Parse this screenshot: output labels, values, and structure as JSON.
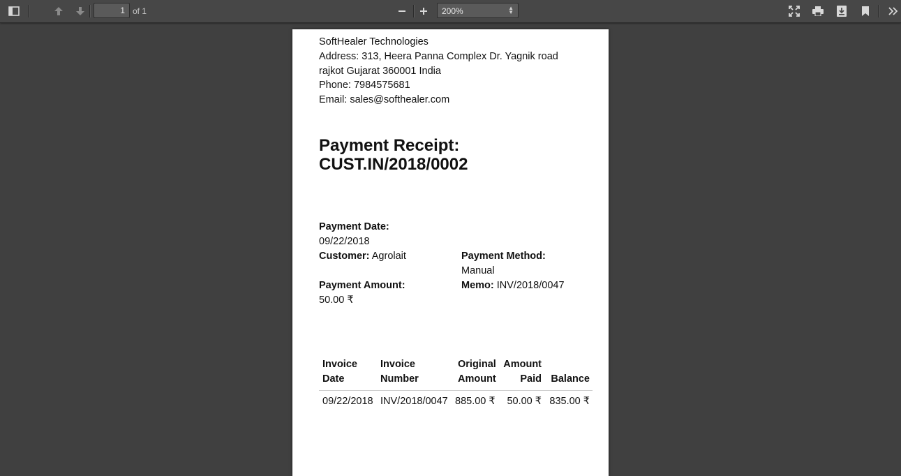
{
  "toolbar": {
    "page_current": "1",
    "page_total": "of 1",
    "zoom": "200%"
  },
  "company": {
    "name": "SoftHealer Technologies",
    "address_line1": "Address: 313, Heera Panna Complex Dr. Yagnik road",
    "address_line2": "rajkot Gujarat 360001 India",
    "phone": "Phone: 7984575681",
    "email": "Email: sales@softhealer.com"
  },
  "receipt": {
    "title_line1": "Payment Receipt:",
    "title_line2": "CUST.IN/2018/0002",
    "payment_date_label": "Payment Date:",
    "payment_date": "09/22/2018",
    "customer_label": "Customer:",
    "customer": "Agrolait",
    "payment_method_label": "Payment Method:",
    "payment_method": "Manual",
    "payment_amount_label": "Payment Amount:",
    "payment_amount": "50.00 ₹",
    "memo_label": "Memo:",
    "memo": "INV/2018/0047"
  },
  "table": {
    "headers": [
      {
        "line1": "Invoice",
        "line2": "Date"
      },
      {
        "line1": "Invoice",
        "line2": "Number"
      },
      {
        "line1": "Original",
        "line2": "Amount"
      },
      {
        "line1": "Amount",
        "line2": "Paid"
      },
      {
        "line1": "",
        "line2": "Balance"
      }
    ],
    "rows": [
      [
        "09/22/2018",
        "INV/2018/0047",
        "885.00 ₹",
        "50.00 ₹",
        "835.00 ₹"
      ]
    ]
  }
}
